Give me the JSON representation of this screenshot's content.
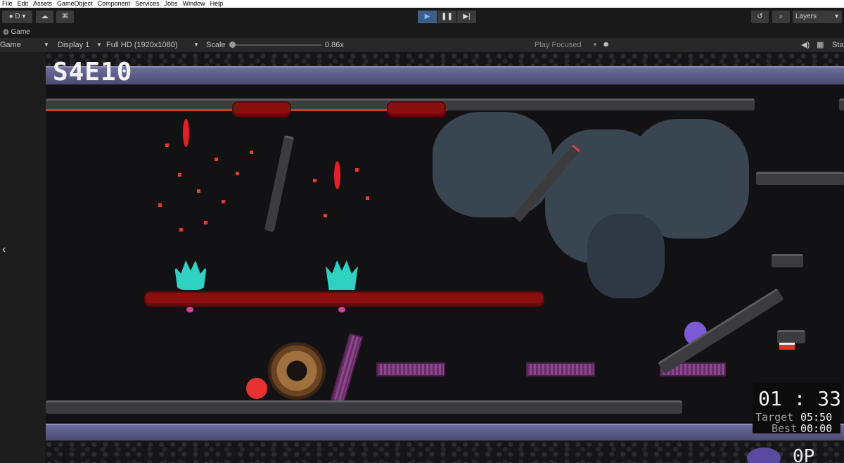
{
  "menu": [
    "File",
    "Edit",
    "Assets",
    "GameObject",
    "Component",
    "Services",
    "Jobs",
    "Window",
    "Help"
  ],
  "toolbar": {
    "account_label": "D",
    "layers_label": "Layers"
  },
  "tab": {
    "label": "Game"
  },
  "gamebar": {
    "mode": "Game",
    "display": "Display 1",
    "resolution": "Full HD (1920x1080)",
    "scale_label": "Scale",
    "scale_value": "0.86x",
    "scale_fraction": 0.0,
    "play_focused": "Play Focused",
    "stats_label": "Sta"
  },
  "game": {
    "level": "S4E10",
    "timer": "01 : 33",
    "target_label": "Target",
    "target_value": "05:50",
    "best_label": "Best",
    "best_value": "00:00",
    "corner_text": "0P"
  },
  "colors": {
    "band": "#5a5a88",
    "red_platform": "#8a1010",
    "purple_platform": "#7a3c7a",
    "plant": "#2fd2c2",
    "lava": "#e0402a"
  }
}
